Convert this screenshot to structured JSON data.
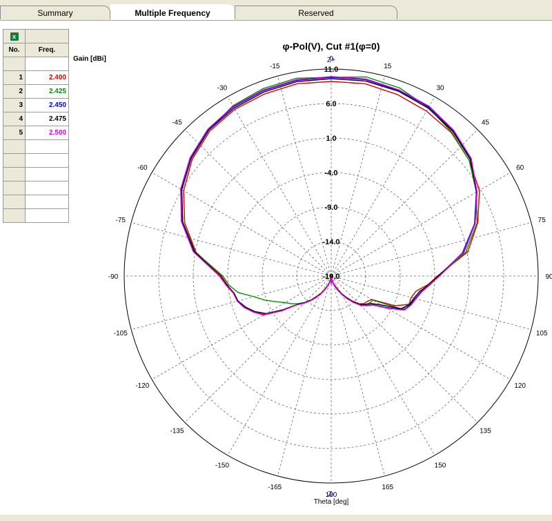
{
  "tabs": [
    {
      "label": "Summary"
    },
    {
      "label": "Multiple Frequency"
    },
    {
      "label": "Reserved"
    }
  ],
  "table": {
    "header": {
      "no": "No.",
      "freq": "Freq."
    },
    "rows": [
      {
        "no": "1",
        "freq": "2.400",
        "color": "#e00000"
      },
      {
        "no": "2",
        "freq": "2.425",
        "color": "#009000"
      },
      {
        "no": "3",
        "freq": "2.450",
        "color": "#0000e0"
      },
      {
        "no": "4",
        "freq": "2.475",
        "color": "#000000"
      },
      {
        "no": "5",
        "freq": "2.500",
        "color": "#e000e0"
      }
    ]
  },
  "chart_data": {
    "type": "polar-line",
    "title": "φ-Pol(V), Cut #1(φ=0)",
    "ylabel": "Gain [dBi]",
    "xlabel": "Theta [deg]",
    "top_label": "Z+",
    "bottom_label": "Z-",
    "radial_ticks": [
      "11.0",
      "6.0",
      "1.0",
      "-4.0",
      "-9.0",
      "-14.0",
      "-19.0"
    ],
    "r_range": [
      -19,
      11
    ],
    "angle_ticks": [
      "0",
      "15",
      "30",
      "45",
      "60",
      "75",
      "90",
      "105",
      "120",
      "135",
      "150",
      "165",
      "180",
      "-165",
      "-150",
      "-135",
      "-120",
      "-105",
      "-90",
      "-75",
      "-60",
      "-45",
      "-30",
      "-15"
    ],
    "grid": true,
    "theta": [
      0,
      10,
      20,
      30,
      40,
      50,
      60,
      70,
      80,
      90,
      95,
      100,
      105,
      110,
      115,
      120,
      125,
      130,
      135,
      140,
      145,
      150,
      155,
      160,
      165,
      170,
      175,
      180,
      185,
      190,
      195,
      200,
      205,
      210,
      215,
      220,
      225,
      230,
      235,
      240,
      245,
      250,
      255,
      260,
      265,
      270,
      280,
      290,
      300,
      310,
      320,
      330,
      340,
      350
    ],
    "series": [
      {
        "name": "2.400",
        "color": "#e00000",
        "values": [
          9.2,
          9.3,
          9.0,
          8.6,
          8.1,
          7.1,
          5.8,
          3.6,
          1.1,
          -3.6,
          -4.9,
          -6.5,
          -7.0,
          -7.0,
          -8.8,
          -12.2,
          -12.6,
          -12.8,
          -13.3,
          -14.3,
          -15.3,
          -16.1,
          -17.0,
          -17.6,
          -18.1,
          -18.6,
          -18.9,
          -18.0,
          -18.9,
          -18.6,
          -18.1,
          -17.6,
          -17.0,
          -16.2,
          -15.5,
          -14.5,
          -13.5,
          -12.6,
          -10.2,
          -7.7,
          -6.6,
          -5.6,
          -4.9,
          -4.7,
          -3.9,
          -3.1,
          0.9,
          3.6,
          5.7,
          7.3,
          8.4,
          8.9,
          9.1,
          9.3
        ]
      },
      {
        "name": "2.425",
        "color": "#009000",
        "values": [
          9.8,
          10.3,
          10.0,
          9.2,
          8.2,
          7.1,
          5.3,
          3.5,
          0.8,
          -3.4,
          -4.6,
          -5.7,
          -6.3,
          -7.1,
          -7.6,
          -12.0,
          -12.2,
          -12.3,
          -13.1,
          -14.1,
          -15.1,
          -16.0,
          -16.8,
          -17.4,
          -18.0,
          -18.5,
          -18.8,
          -18.0,
          -18.8,
          -18.5,
          -18.0,
          -17.5,
          -16.9,
          -16.1,
          -15.3,
          -14.5,
          -13.6,
          -12.8,
          -12.0,
          -11.3,
          -10.2,
          -8.8,
          -7.4,
          -5.3,
          -4.1,
          -3.3,
          1.0,
          3.9,
          6.1,
          7.6,
          8.6,
          9.5,
          9.9,
          10.1
        ]
      },
      {
        "name": "2.450",
        "color": "#0000e0",
        "values": [
          9.8,
          9.9,
          9.6,
          9.3,
          8.5,
          7.4,
          5.3,
          3.1,
          0.3,
          -3.4,
          -4.8,
          -5.8,
          -6.4,
          -6.8,
          -7.4,
          -9.9,
          -11.8,
          -12.4,
          -13.1,
          -14.1,
          -15.1,
          -16.0,
          -16.8,
          -17.4,
          -18.0,
          -18.5,
          -18.8,
          -18.0,
          -18.8,
          -18.5,
          -18.0,
          -17.5,
          -16.9,
          -16.1,
          -15.3,
          -14.4,
          -13.5,
          -12.6,
          -10.4,
          -8.1,
          -6.8,
          -5.8,
          -5.0,
          -4.7,
          -3.8,
          -2.9,
          1.2,
          4.0,
          6.1,
          7.6,
          8.7,
          9.3,
          9.6,
          9.8
        ]
      },
      {
        "name": "2.475",
        "color": "#000000",
        "values": [
          9.6,
          9.7,
          9.5,
          9.1,
          8.4,
          7.3,
          5.4,
          3.2,
          0.5,
          -3.5,
          -4.8,
          -6.0,
          -6.6,
          -6.9,
          -7.8,
          -10.6,
          -12.1,
          -12.6,
          -13.2,
          -14.2,
          -15.2,
          -16.1,
          -16.9,
          -17.5,
          -18.0,
          -18.5,
          -18.8,
          -18.0,
          -18.8,
          -18.5,
          -18.0,
          -17.5,
          -16.9,
          -16.1,
          -15.3,
          -14.4,
          -13.5,
          -12.6,
          -10.5,
          -8.1,
          -6.8,
          -5.8,
          -5.0,
          -4.7,
          -3.8,
          -2.9,
          1.1,
          3.9,
          6.0,
          7.5,
          8.6,
          9.1,
          9.4,
          9.6
        ]
      },
      {
        "name": "2.500",
        "color": "#e000e0",
        "values": [
          9.9,
          10.0,
          9.7,
          9.4,
          8.6,
          7.5,
          5.4,
          3.2,
          0.4,
          -3.3,
          -4.7,
          -5.7,
          -6.3,
          -6.7,
          -7.3,
          -9.7,
          -11.7,
          -12.3,
          -13.0,
          -14.0,
          -15.0,
          -15.9,
          -16.7,
          -17.3,
          -17.9,
          -18.4,
          -18.7,
          -17.8,
          -18.7,
          -18.4,
          -17.9,
          -17.4,
          -16.8,
          -16.0,
          -15.2,
          -14.3,
          -13.4,
          -12.5,
          -10.2,
          -7.9,
          -6.6,
          -5.6,
          -4.9,
          -4.6,
          -3.7,
          -2.8,
          1.3,
          4.1,
          6.2,
          7.7,
          8.8,
          9.4,
          9.7,
          9.9
        ]
      }
    ]
  }
}
